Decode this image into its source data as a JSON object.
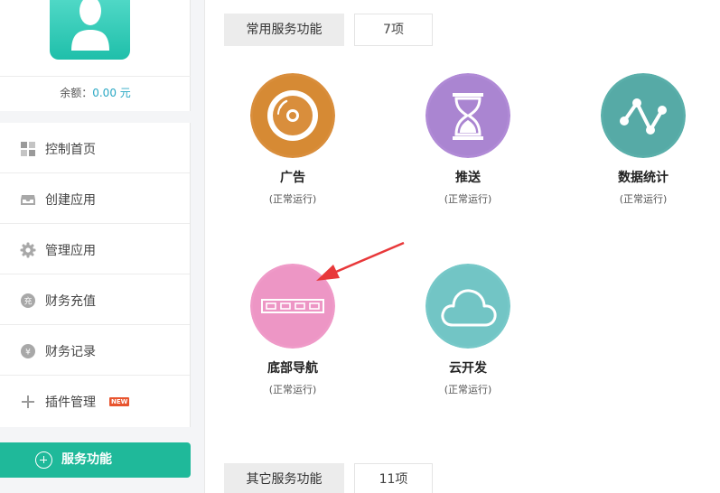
{
  "profile": {
    "balance_label": "余额：",
    "balance_amount": "0.00 元"
  },
  "sidebar": {
    "items": [
      {
        "label": "控制首页",
        "icon": "dashboard-grid-icon"
      },
      {
        "label": "创建应用",
        "icon": "inbox-tray-icon"
      },
      {
        "label": "管理应用",
        "icon": "gear-icon"
      },
      {
        "label": "财务充值",
        "icon": "recharge-coin-icon",
        "glyph": "充"
      },
      {
        "label": "财务记录",
        "icon": "yen-coin-icon",
        "glyph": "¥"
      },
      {
        "label": "插件管理",
        "icon": "plus-icon",
        "badge": "NEW"
      }
    ],
    "service_button_label": "服务功能"
  },
  "sections": {
    "common": {
      "title": "常用服务功能",
      "count": "7项"
    },
    "other": {
      "title": "其它服务功能",
      "count": "11项"
    }
  },
  "services": [
    {
      "name": "广告",
      "status": "(正常运行)",
      "icon": "disc-icon",
      "color": "#d98e3c"
    },
    {
      "name": "推送",
      "status": "(正常运行)",
      "icon": "hourglass-icon",
      "color": "#b08ad6"
    },
    {
      "name": "数据统计",
      "status": "(正常运行)",
      "icon": "line-graph-icon",
      "color": "#5aafaa"
    },
    {
      "name": "底部导航",
      "status": "(正常运行)",
      "icon": "tab-bar-icon",
      "color": "#ef9ac8"
    },
    {
      "name": "云开发",
      "status": "(正常运行)",
      "icon": "cloud-icon",
      "color": "#76c8c8"
    }
  ],
  "colors": {
    "accent": "#1fb99a",
    "balance_amount": "#2aa8c4",
    "badge": "#e8542e",
    "annotation_arrow": "#e8383a"
  }
}
